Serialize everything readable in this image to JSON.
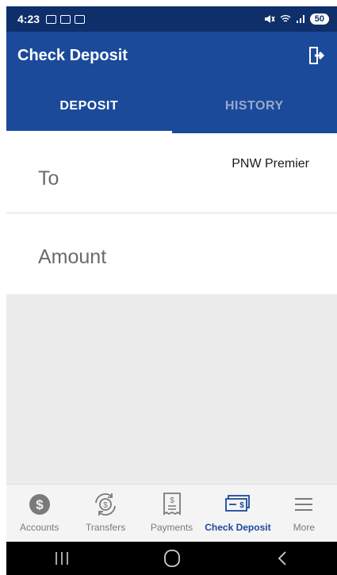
{
  "status_bar": {
    "time": "4:23",
    "battery": "50"
  },
  "app_bar": {
    "title": "Check Deposit",
    "exit_icon": "logout-icon"
  },
  "tabs": [
    {
      "label": "DEPOSIT",
      "active": true
    },
    {
      "label": "HISTORY",
      "active": false
    }
  ],
  "form": {
    "to_label": "To",
    "to_value": "PNW Premier",
    "amount_label": "Amount"
  },
  "bottom_nav": {
    "items": [
      {
        "label": "Accounts",
        "icon": "dollar-circle-icon"
      },
      {
        "label": "Transfers",
        "icon": "transfer-cycle-icon"
      },
      {
        "label": "Payments",
        "icon": "bill-icon"
      },
      {
        "label": "Check Deposit",
        "icon": "check-icon",
        "active": true
      },
      {
        "label": "More",
        "icon": "menu-icon"
      }
    ]
  },
  "colors": {
    "primary": "#1b4a9b",
    "status_bar": "#0f2f6b",
    "background": "#ececec"
  }
}
